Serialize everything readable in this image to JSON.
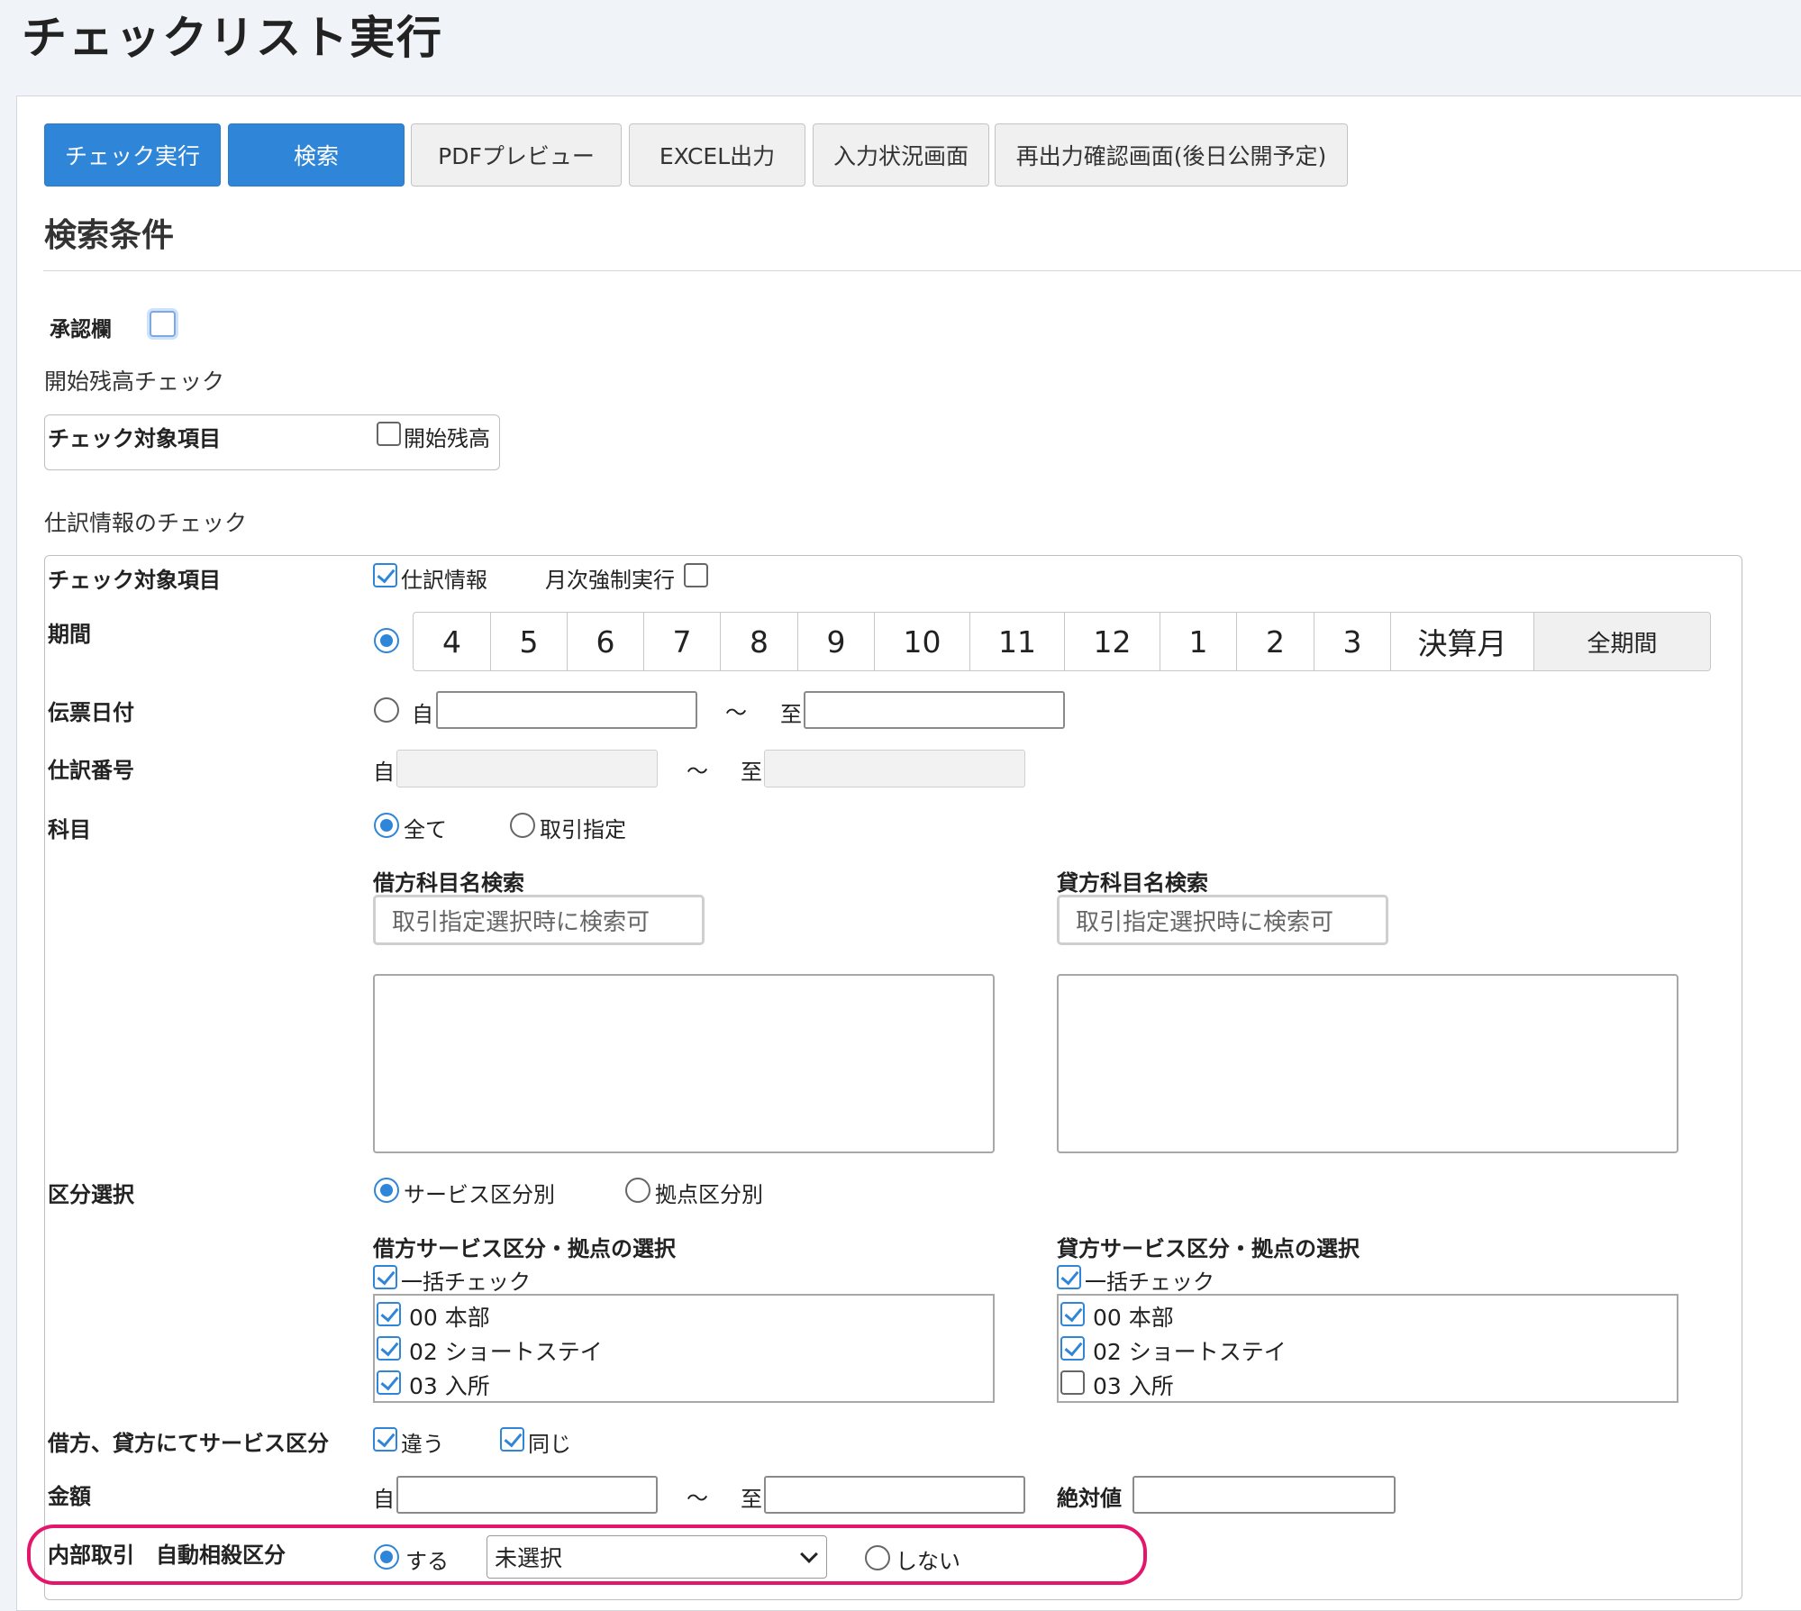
{
  "page": {
    "title": "チェックリスト実行"
  },
  "toolbar": {
    "buttons": [
      "チェック実行",
      "検索",
      "PDFプレビュー",
      "EXCEL出力",
      "入力状況画面",
      "再出力確認画面(後日公開予定)"
    ]
  },
  "search": {
    "heading": "検索条件",
    "approval_label": "承認欄",
    "opening": {
      "section": "開始残高チェック",
      "target_label": "チェック対象項目",
      "checkbox_label": "開始残高"
    },
    "journal": {
      "section": "仕訳情報のチェック",
      "target_label": "チェック対象項目",
      "journal_info": "仕訳情報",
      "monthly_force": "月次強制実行",
      "period_label": "期間",
      "months": [
        "4",
        "5",
        "6",
        "7",
        "8",
        "9",
        "10",
        "11",
        "12",
        "1",
        "2",
        "3",
        "決算月",
        "全期間"
      ],
      "slip_date_label": "伝票日付",
      "from": "自",
      "tilde": "〜",
      "to": "至",
      "journal_no_label": "仕訳番号",
      "account_label": "科目",
      "account_all": "全て",
      "account_specify": "取引指定",
      "debit_search_label": "借方科目名検索",
      "credit_search_label": "貸方科目名検索",
      "search_placeholder": "取引指定選択時に検索可",
      "division_label": "区分選択",
      "by_service": "サービス区分別",
      "by_base": "拠点区分別",
      "debit_service_label": "借方サービス区分・拠点の選択",
      "credit_service_label": "貸方サービス区分・拠点の選択",
      "bulk_check": "一括チェック",
      "service_items": [
        "00 本部",
        "02 ショートステイ",
        "03 入所"
      ],
      "debit_credit_label": "借方、貸方にてサービス区分",
      "different": "違う",
      "same": "同じ",
      "amount_label": "金額",
      "absolute_label": "絶対値",
      "internal_label": "内部取引　自動相殺区分",
      "do": "する",
      "select_value": "未選択",
      "dont": "しない"
    }
  },
  "colors": {
    "primary": "#2f86d8",
    "highlight": "#e3166b"
  }
}
